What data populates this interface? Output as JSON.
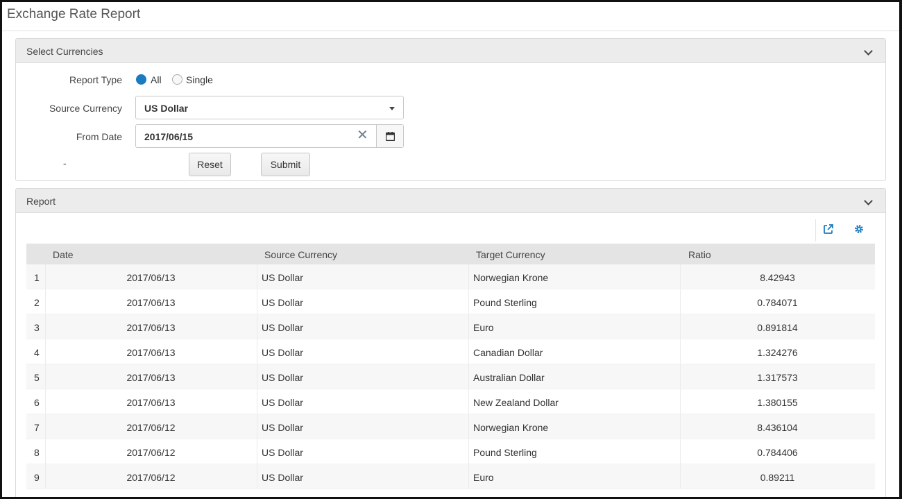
{
  "page": {
    "title": "Exchange Rate Report"
  },
  "select_panel": {
    "title": "Select Currencies",
    "report_type": {
      "label": "Report Type",
      "options": [
        "All",
        "Single"
      ],
      "selected": "All"
    },
    "source_currency": {
      "label": "Source Currency",
      "value": "US Dollar"
    },
    "from_date": {
      "label": "From Date",
      "value": "2017/06/15"
    },
    "dash": "-",
    "reset_label": "Reset",
    "submit_label": "Submit"
  },
  "report_panel": {
    "title": "Report",
    "columns": [
      "Date",
      "Source Currency",
      "Target Currency",
      "Ratio"
    ],
    "rows": [
      {
        "num": "1",
        "date": "2017/06/13",
        "source": "US Dollar",
        "target": "Norwegian Krone",
        "ratio": "8.42943"
      },
      {
        "num": "2",
        "date": "2017/06/13",
        "source": "US Dollar",
        "target": "Pound Sterling",
        "ratio": "0.784071"
      },
      {
        "num": "3",
        "date": "2017/06/13",
        "source": "US Dollar",
        "target": "Euro",
        "ratio": "0.891814"
      },
      {
        "num": "4",
        "date": "2017/06/13",
        "source": "US Dollar",
        "target": "Canadian Dollar",
        "ratio": "1.324276"
      },
      {
        "num": "5",
        "date": "2017/06/13",
        "source": "US Dollar",
        "target": "Australian Dollar",
        "ratio": "1.317573"
      },
      {
        "num": "6",
        "date": "2017/06/13",
        "source": "US Dollar",
        "target": "New Zealand Dollar",
        "ratio": "1.380155"
      },
      {
        "num": "7",
        "date": "2017/06/12",
        "source": "US Dollar",
        "target": "Norwegian Krone",
        "ratio": "8.436104"
      },
      {
        "num": "8",
        "date": "2017/06/12",
        "source": "US Dollar",
        "target": "Pound Sterling",
        "ratio": "0.784406"
      },
      {
        "num": "9",
        "date": "2017/06/12",
        "source": "US Dollar",
        "target": "Euro",
        "ratio": "0.89211"
      }
    ]
  },
  "colors": {
    "accent": "#1a7bc0",
    "panel_header": "#ececec",
    "table_header": "#e4e4e4"
  },
  "icons": {
    "collapse": "chevron-down-icon",
    "export": "export-icon",
    "settings": "gear-icon",
    "calendar": "calendar-icon",
    "clear": "close-icon"
  }
}
